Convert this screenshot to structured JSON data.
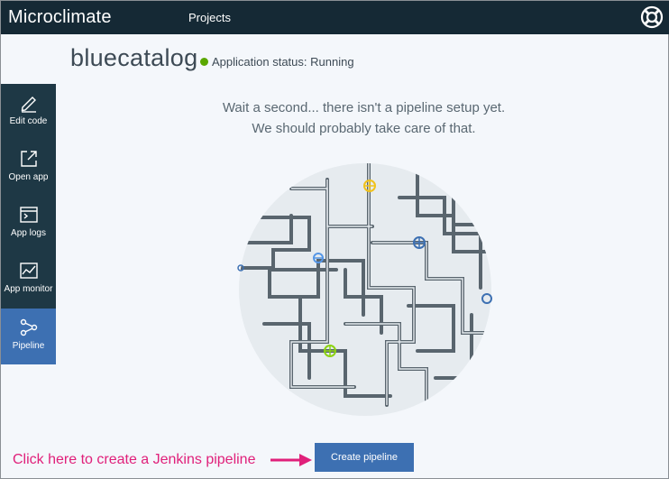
{
  "header": {
    "brand": "Microclimate",
    "nav_projects": "Projects",
    "help_icon": "lifebuoy-icon",
    "background_color": "#152935"
  },
  "app": {
    "name": "bluecatalog",
    "status_text": "Application status: Running",
    "status_color": "#5aa700"
  },
  "sidebar": {
    "items": [
      {
        "label": "Edit code",
        "icon": "pencil-icon"
      },
      {
        "label": "Open app",
        "icon": "launch-icon"
      },
      {
        "label": "App logs",
        "icon": "terminal-icon"
      },
      {
        "label": "App monitor",
        "icon": "monitor-icon"
      },
      {
        "label": "Pipeline",
        "icon": "pipeline-icon",
        "active": true
      }
    ],
    "background_color": "#1e3845",
    "active_color": "#3d70b2"
  },
  "main": {
    "message_line1": "Wait a second... there isn't a pipeline setup yet.",
    "message_line2": "We should probably take care of that.",
    "illustration": "pipes-illustration",
    "create_button": "Create pipeline"
  },
  "annotation": {
    "text": "Click here to create a Jenkins pipeline",
    "color": "#e0207a"
  }
}
